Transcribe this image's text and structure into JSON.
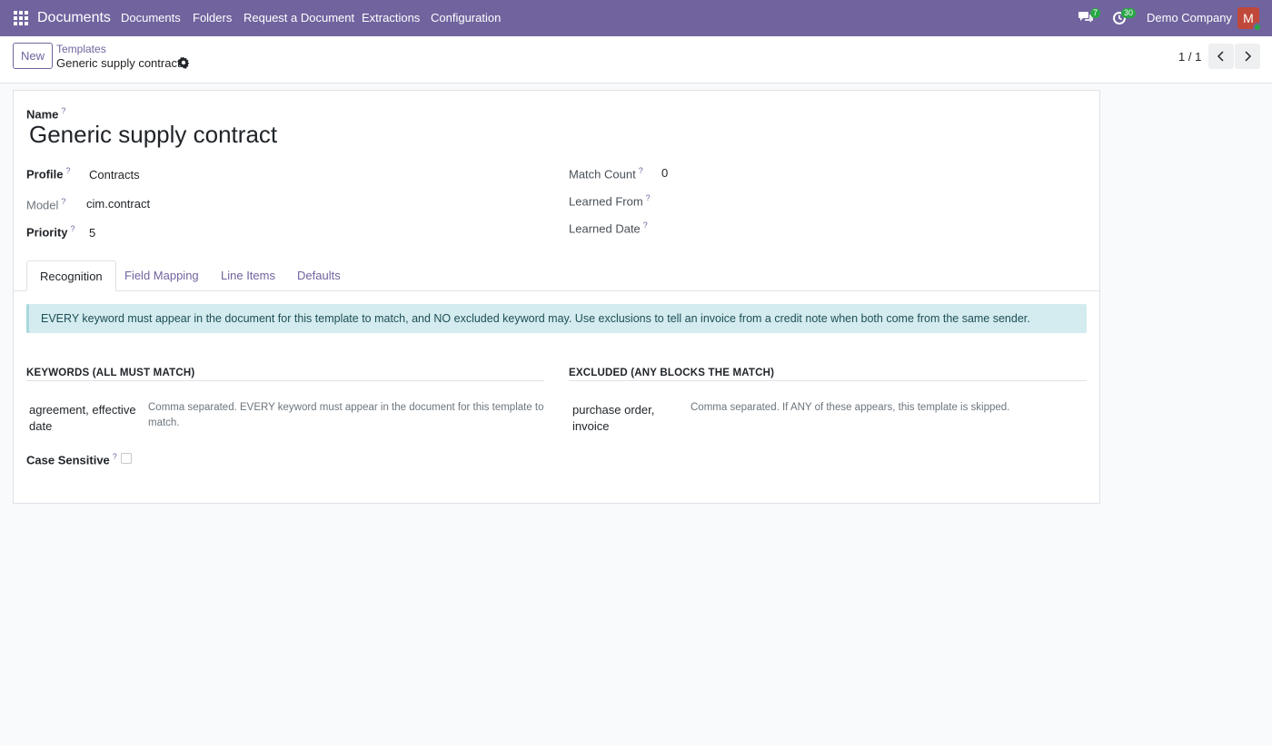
{
  "navbar": {
    "brand": "Documents",
    "menu": [
      "Documents",
      "Folders",
      "Request a Document",
      "Extractions",
      "Configuration"
    ],
    "messages_count": "7",
    "activities_count": "30",
    "company": "Demo Company",
    "avatar_letter": "M",
    "colors": {
      "bar": "#71639e",
      "badge": "#28a745",
      "avatar": "#c0483a"
    }
  },
  "control": {
    "new_label": "New",
    "breadcrumb_parent": "Templates",
    "record_name": "Generic supply contract",
    "pager": "1 / 1"
  },
  "form": {
    "name_label": "Name",
    "name_value": "Generic supply contract",
    "profile_label": "Profile",
    "profile_value": "Contracts",
    "model_label": "Model",
    "model_value": "cim.contract",
    "priority_label": "Priority",
    "priority_value": "5",
    "match_count_label": "Match Count",
    "match_count_value": "0",
    "learned_from_label": "Learned From",
    "learned_date_label": "Learned Date",
    "help_mark": "?"
  },
  "tabs": [
    "Recognition",
    "Field Mapping",
    "Line Items",
    "Defaults"
  ],
  "recognition": {
    "alert": "EVERY keyword must appear in the document for this template to match, and NO excluded keyword may. Use exclusions to tell an invoice from a credit note when both come from the same sender.",
    "keywords_title": "KEYWORDS (ALL MUST MATCH)",
    "keywords_value": "agreement, effective date",
    "keywords_help": "Comma separated. EVERY keyword must appear in the document for this template to match.",
    "excluded_title": "EXCLUDED (ANY BLOCKS THE MATCH)",
    "excluded_value": "purchase order, invoice",
    "excluded_help": "Comma separated. If ANY of these appears, this template is skipped.",
    "case_sensitive_label": "Case Sensitive",
    "case_sensitive_checked": false
  }
}
